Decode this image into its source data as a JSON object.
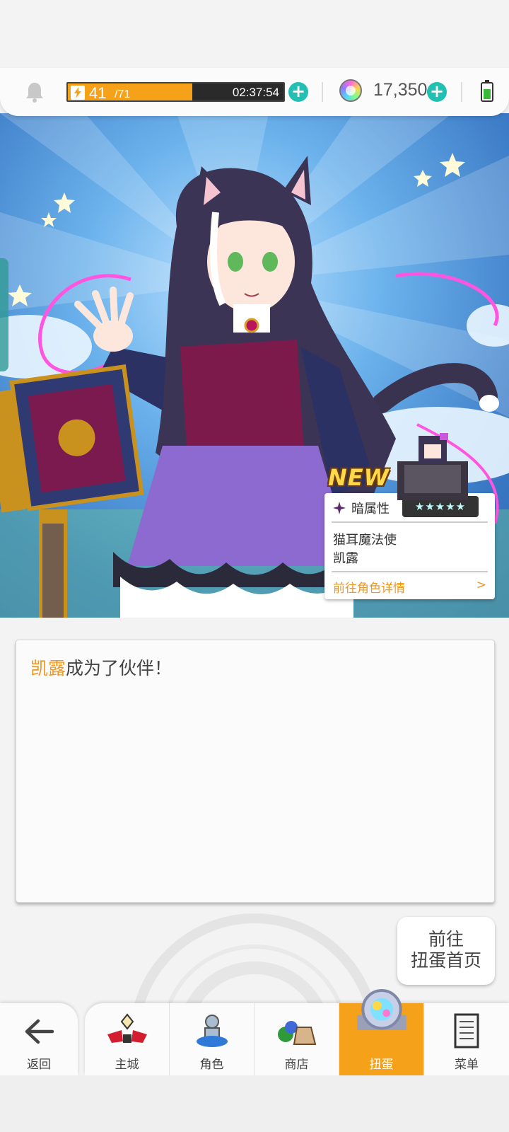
{
  "status_bar": {
    "stamina_current": "41",
    "stamina_max": "/71",
    "stamina_fraction": 0.577,
    "stamina_timer": "02:37:54",
    "gems": "17,350",
    "plus_symbol": "+"
  },
  "character_card": {
    "new_badge": "NEW",
    "attribute": "暗属性",
    "stars": "★★★★★",
    "title": "猫耳魔法使",
    "name": "凯露",
    "detail_link": "前往角色详情",
    "detail_arrow": ">"
  },
  "message": {
    "name": "凯露",
    "text": "成为了伙伴！"
  },
  "goto_gacha_button": {
    "line1": "前往",
    "line2": "扭蛋首页"
  },
  "nav": {
    "back": "返回",
    "items": [
      {
        "label": "主城",
        "icon": "castle-icon"
      },
      {
        "label": "角色",
        "icon": "character-icon"
      },
      {
        "label": "商店",
        "icon": "shop-icon"
      },
      {
        "label": "扭蛋",
        "icon": "gacha-icon",
        "active": true
      },
      {
        "label": "菜单",
        "icon": "menu-icon"
      }
    ]
  },
  "colors": {
    "accent_orange": "#f5a11a",
    "highlight_name": "#ee9722",
    "plus_teal": "#21c0b2"
  }
}
